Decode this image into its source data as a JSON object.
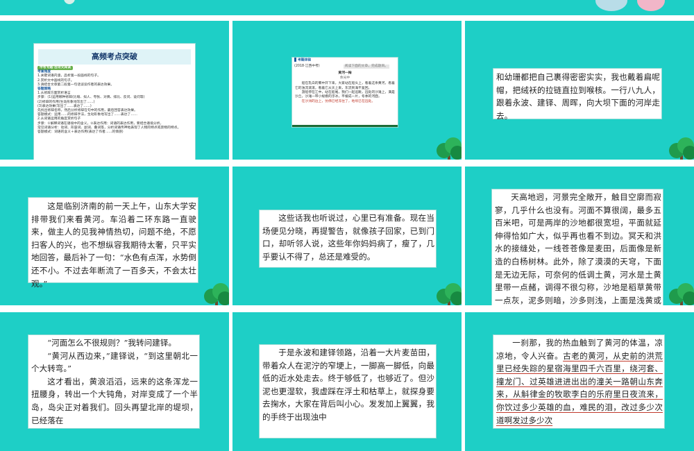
{
  "colors": {
    "slide_bg": "#1ecfc6",
    "page_bg": "#ffffff",
    "title_blue": "#14386b",
    "underline_red": "#c0392b"
  },
  "slide1": {
    "title": "高频考点突破",
    "tag": "中考专题·古诗文阅读",
    "section1": "考查角度",
    "items": [
      "1.关键词语内涵，品析第一段画线的句子。",
      "2.赏析文中画线的句子。",
      "3.请结合文章第二段第一句话谈谈作者的表达效果。"
    ],
    "section2": "答题策略",
    "steps": [
      "1.从修辞方面赏析语言",
      "步骤：(1)运用哪种修辞(比喻、拟人、夸张、对偶、排比、反问、设问等)",
      "(2)修辞的作用(生动形象地写出了……)",
      "(3)表达效果(写出了……表达了……)",
      "先找出修辞名称，然后分析修辞在句中的作用，最后回答表达效果。",
      "答题模式：运用……的修辞手法，生动形象地写出了……表达了……",
      "2.从词语运用的角度赏析句子",
      "步骤：①解释词语在语境中的含义。②表达作用：词语的表达作用，要结合语境分析。",
      "常见词语分析：动词、形容词、副词、叠词等，分析词语传神地表现了人物的特点或景物的特点。",
      "答题模式：词语的含义＋表达作用(表达了作者……的情感)"
    ]
  },
  "slide2": {
    "head": "考题体验",
    "source": "(2018·江西中考)",
    "stamp": "阅读下面的文章，完成题目。",
    "poem_title": "黄河一掬",
    "author": "余光中",
    "body": [
      "船在乳白的雾中开下来，大家站在船头上，看着这条黄河，看着它的浊流滚滚，看着它从天上来，东流到海不复回。",
      "游船停在江中，站在船尾，我们一起远眺，远处的沙滩上，满是沙丘，沙滩一带小规模的浮冰，平缓成一片，冬季的河面，",
      "在沙洲的边上，仿佛已经冻住了，地坝已在远处。"
    ]
  },
  "slide3": {
    "text": "和幼珊都把自己裹得密密实实，我也戴着扁呢帽，把绒袄的拉链直拉到喉核。一行八九人，跟着永波、建铎、周晖，向大坝下面的河岸走去。"
  },
  "slide4": {
    "text": "这是临别济南的前一天上午，山东大学安排带我们来看黄河。车沿着二环东路一直驶来，做主人的见我神情热切，问题不绝，不愿扫客人的兴，也不想纵容我期待太奢，只平实地回答，最后补了一句：“水色有点浑，水势倒还不小。不过去年断流了一百多天，不会太壮观。”"
  },
  "slide5": {
    "text": "这些话我也听说过，心里已有准备。现在当场便见分晓，再提警告，就像孩子回家，已到门口，却听邻人说，这些年你妈妈病了，瘦了，几乎要认不得了，总还是难受的。"
  },
  "slide6": {
    "text": "天高地迥，河景完全敞开，触目空廓而寂寥，几乎什么也没有。河面不算很阔，最多五百米吧，可是两岸的沙地都很宽坦，平面就延伸得恰如广大，似乎再也看不到边。冥天和洪水的接缝处，一线苍苍像是麦田，后面像是新造的白杨树林。此外，除了漠漠的天穹，下面是无边无际，可奈何的低调土黄，河水是土黄里带一点赭，调得不很匀称，沙地是稻草黄带一点灰，泥多则暗，沙多则浅，上面是浅黄或发白的枯草。"
  },
  "slide7": {
    "p1": "“河面怎么不很规则？”我转问建铎。",
    "p2": "“黄河从西边来，”建铎说，“到这里朝北一个大转弯。”",
    "p3": "这才看出，黄浪滔滔，远来的这条浑龙一扭腰身，转出一个大钝角，对岸变成了一个半岛，岛尖正对着我们。回头再望北岸的堤坝，已经落在"
  },
  "slide8": {
    "text": "于是永波和建铎领路，沿着一大片麦苗田，带着众人在泥泞的窄埂上，一脚高一脚低，向最低的近水处走去。终于够低了，也够近了。但沙泥也更湿软，我虚踩在浮土和枯草上，就探身要去掬水，大家在背后叫小心。发发加上翼翼，我的手终于出现浊中"
  },
  "slide9": {
    "lead": "一刹那，我的热血触到了黄河的体温，凉凉地，令人兴奋。",
    "ul": "古老的黄河，从史前的洪荒里已经失踪的星宿海里四千六百里，绕河套、撞龙门、过英雄进进出出的潼关一路朝山东奔来，从斛律金的牧歌李白的乐府里日夜流来，你饮过多少英雄的血，难民的泪，改过多少次道啊发过多少次"
  }
}
